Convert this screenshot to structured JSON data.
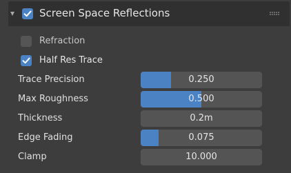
{
  "panel": {
    "title": "Screen Space Reflections",
    "enabled": true,
    "expanded": true,
    "accent_color": "#4a82c3"
  },
  "options": [
    {
      "label": "Refraction",
      "checked": false
    },
    {
      "label": "Half Res Trace",
      "checked": true
    }
  ],
  "properties": [
    {
      "label": "Trace Precision",
      "value": "0.250",
      "fill_fraction": 0.25
    },
    {
      "label": "Max Roughness",
      "value": "0.500",
      "fill_fraction": 0.5
    },
    {
      "label": "Thickness",
      "value": "0.2m",
      "fill_fraction": 0
    },
    {
      "label": "Edge Fading",
      "value": "0.075",
      "fill_fraction": 0.15
    },
    {
      "label": "Clamp",
      "value": "10.000",
      "fill_fraction": 0
    }
  ]
}
